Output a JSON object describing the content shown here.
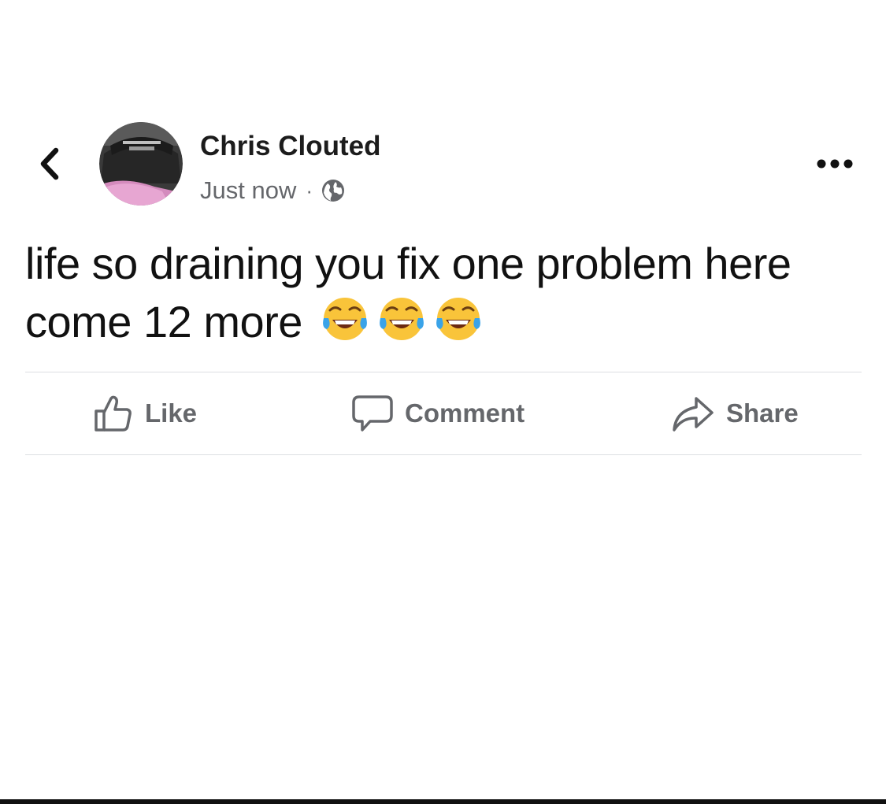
{
  "nav": {
    "back_icon": "chevron-left-icon"
  },
  "post": {
    "author_name": "Chris Clouted",
    "timestamp": "Just now",
    "separator": "·",
    "privacy_icon": "globe-icon",
    "more_icon": "ellipsis-icon",
    "text": "life so draining you fix one problem here come 12 more",
    "emojis": [
      "face-with-tears-of-joy",
      "face-with-tears-of-joy",
      "face-with-tears-of-joy"
    ]
  },
  "actions": {
    "like_label": "Like",
    "comment_label": "Comment",
    "share_label": "Share"
  },
  "colors": {
    "secondary_text": "#65676b",
    "divider": "#dddfe2"
  }
}
